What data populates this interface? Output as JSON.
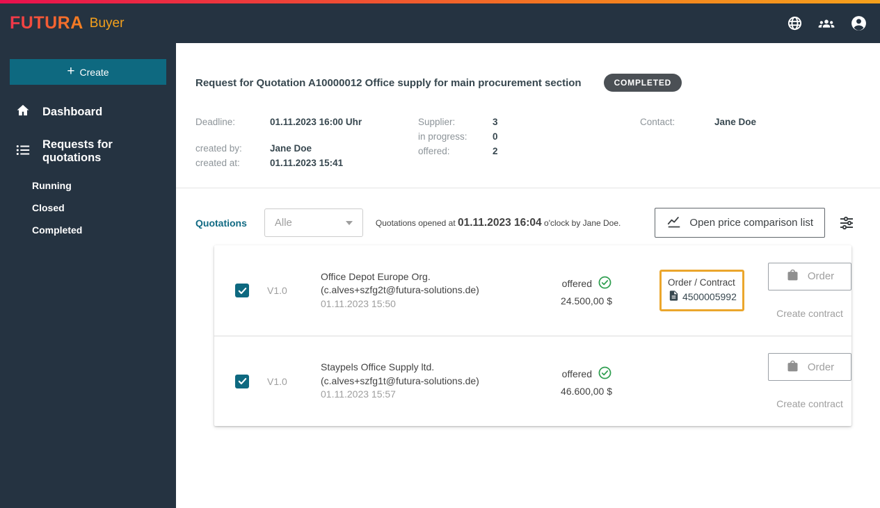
{
  "topbar": {
    "logo": "FUTURA",
    "logo_suffix": "Buyer",
    "icons": [
      "globe-icon",
      "users-icon",
      "account-icon"
    ]
  },
  "sidebar": {
    "create_label": "Create",
    "dashboard_label": "Dashboard",
    "requests_label": "Requests for quotations",
    "sub_items": {
      "running": "Running",
      "closed": "Closed",
      "completed": "Completed"
    }
  },
  "header": {
    "title": "Request for Quotation A10000012 Office supply for main procurement section",
    "status_badge": "COMPLETED",
    "details": {
      "deadline_label": "Deadline:",
      "deadline": "01.11.2023 16:00 Uhr",
      "created_by_label": "created by:",
      "created_by": "Jane Doe",
      "created_at_label": "created at:",
      "created_at": "01.11.2023 15:41",
      "supplier_label": "Supplier:",
      "supplier": "3",
      "in_progress_label": "in progress:",
      "in_progress": "0",
      "offered_label": "offered:",
      "offered": "2",
      "contact_label": "Contact:",
      "contact": "Jane Doe"
    }
  },
  "quotations": {
    "section_label": "Quotations",
    "filter_value": "Alle",
    "opened_prefix": "Quotations opened at",
    "opened_time": "01.11.2023 16:04",
    "opened_suffix": "o'clock by Jane Doe.",
    "price_comparison_label": "Open price comparison list",
    "rows": [
      {
        "version": "V1.0",
        "supplier": "Office Depot Europe Org.",
        "email": "(c.alves+szfg2t@futura-solutions.de)",
        "date": "01.11.2023 15:50",
        "status": "offered",
        "price": "24.500,00 $",
        "order_contract_label": "Order / Contract",
        "order_number": "4500005992",
        "order_label": "Order",
        "create_contract_label": "Create contract"
      },
      {
        "version": "V1.0",
        "supplier": "Staypels Office Supply ltd.",
        "email": "(c.alves+szfg1t@futura-solutions.de)",
        "date": "01.11.2023 15:57",
        "status": "offered",
        "price": "46.600,00 $",
        "order_label": "Order",
        "create_contract_label": "Create contract"
      }
    ]
  },
  "colors": {
    "topbar_bg": "#253341",
    "accent_teal": "#0e6980",
    "section_label_teal": "#116a83",
    "badge_gray": "#4b5055",
    "status_green": "#2e9e4f",
    "highlight_orange": "#eba62c",
    "gradient_left": "#e8104e",
    "gradient_right": "#f5a11c"
  }
}
